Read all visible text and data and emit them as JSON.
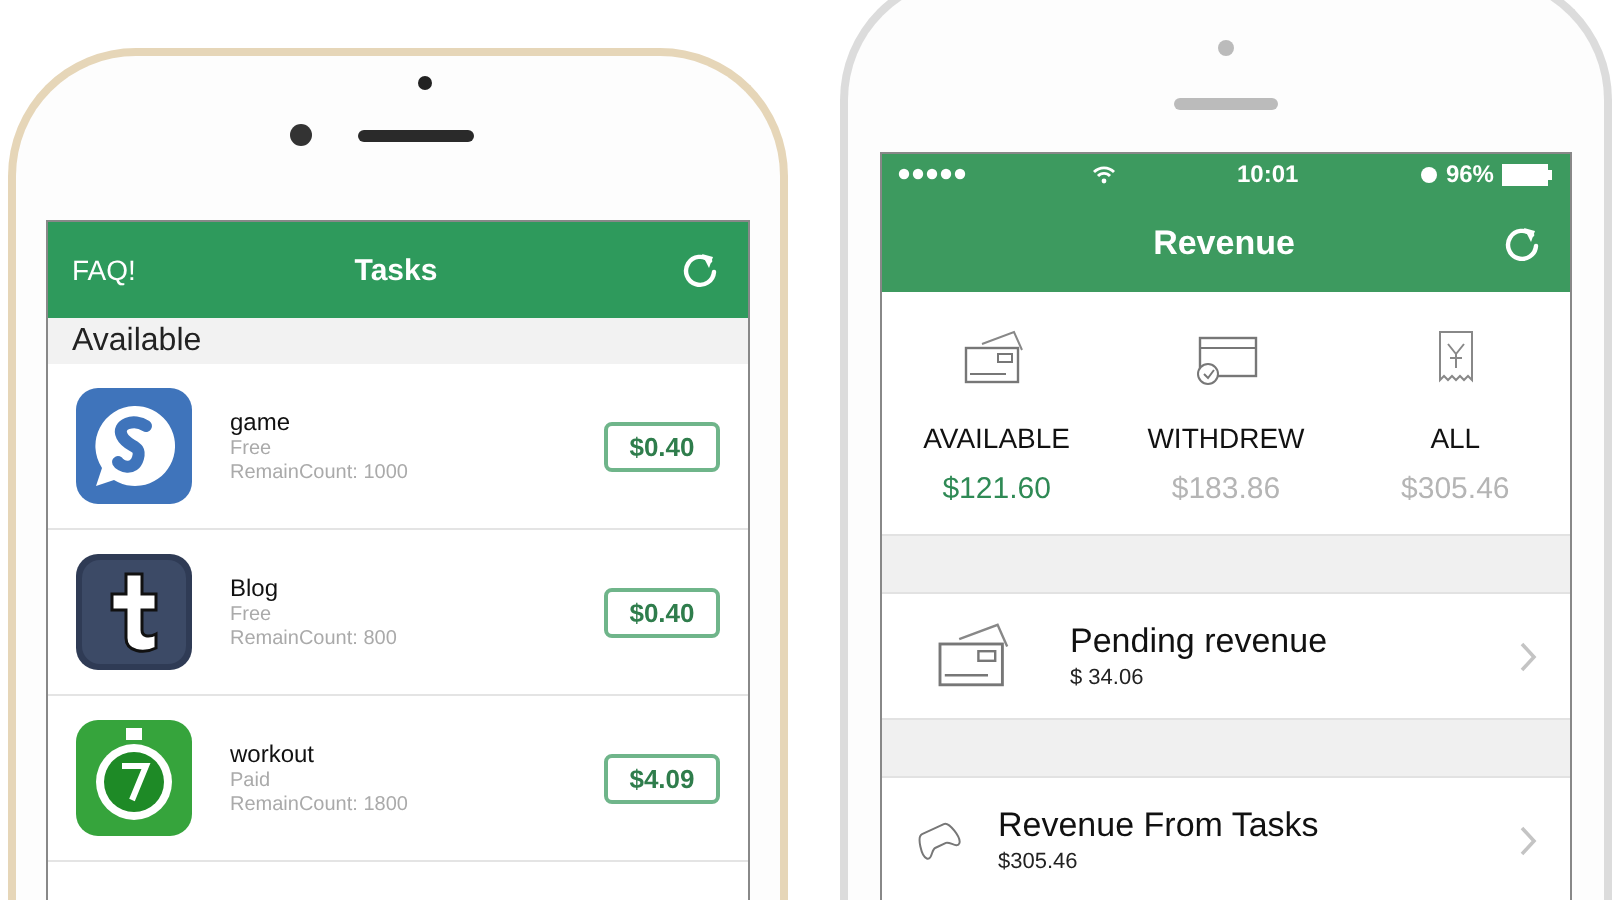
{
  "left_phone": {
    "nav": {
      "left_link": "FAQ!",
      "title": "Tasks"
    },
    "section_title": "Available",
    "tasks": [
      {
        "kind": "chat",
        "name": "game",
        "price_type": "Free",
        "remain": "RemainCount: 1000",
        "reward": "$0.40"
      },
      {
        "kind": "blog",
        "name": "Blog",
        "price_type": "Free",
        "remain": "RemainCount: 800",
        "reward": "$0.40"
      },
      {
        "kind": "timer",
        "name": "workout",
        "price_type": "Paid",
        "remain": "RemainCount: 1800",
        "reward": "$4.09"
      }
    ]
  },
  "right_phone": {
    "status_bar": {
      "time": "10:01",
      "battery": "96%"
    },
    "nav": {
      "title": "Revenue"
    },
    "summary": [
      {
        "kind": "cards",
        "label": "AVAILABLE",
        "amount": "$121.60",
        "selected": true
      },
      {
        "kind": "card",
        "label": "WITHDREW",
        "amount": "$183.86",
        "selected": false
      },
      {
        "kind": "receipt",
        "label": "ALL",
        "amount": "$305.46",
        "selected": false
      }
    ],
    "rows": [
      {
        "kind": "cards",
        "title": "Pending revenue",
        "amount": "$ 34.06"
      },
      {
        "kind": "gamepad",
        "title": "Revenue From Tasks",
        "amount": "$305.46"
      }
    ]
  }
}
